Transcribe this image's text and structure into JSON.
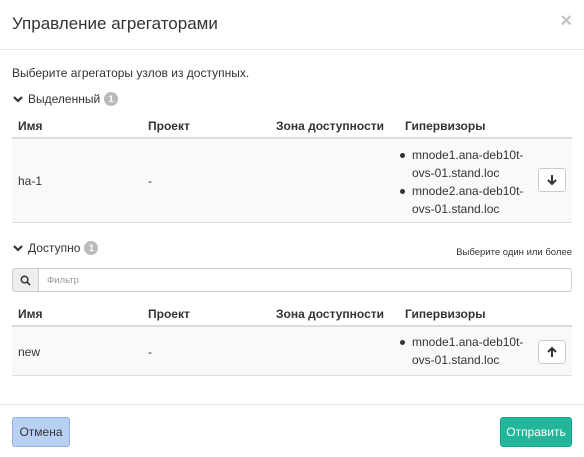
{
  "dialog": {
    "title": "Управление агрегаторами",
    "close_icon": "×",
    "intro": "Выберите агрегаторы узлов из доступных."
  },
  "selected": {
    "label": "Выделенный",
    "count": "1",
    "columns": [
      "Имя",
      "Проект",
      "Зона доступности",
      "Гипервизоры"
    ],
    "rows": [
      {
        "name": "ha-1",
        "project": "-",
        "zone": "",
        "hypervisors": [
          "mnode1.ana-deb10t-ovs-01.stand.loc",
          "mnode2.ana-deb10t-ovs-01.stand.loc"
        ],
        "action_icon": "arrow-down-icon"
      }
    ]
  },
  "available": {
    "label": "Доступно",
    "count": "1",
    "hint": "Выберите один или более",
    "filter_placeholder": "Фильтр",
    "columns": [
      "Имя",
      "Проект",
      "Зона доступности",
      "Гипервизоры"
    ],
    "rows": [
      {
        "name": "new",
        "project": "-",
        "zone": "",
        "hypervisors": [
          "mnode1.ana-deb10t-ovs-01.stand.loc"
        ],
        "action_icon": "arrow-up-icon"
      }
    ]
  },
  "footer": {
    "cancel_label": "Отмена",
    "submit_label": "Отправить"
  },
  "colors": {
    "cancel_bg": "#b7d0f4",
    "submit_bg": "#22b79a",
    "badge_bg": "#bbbbbb"
  }
}
